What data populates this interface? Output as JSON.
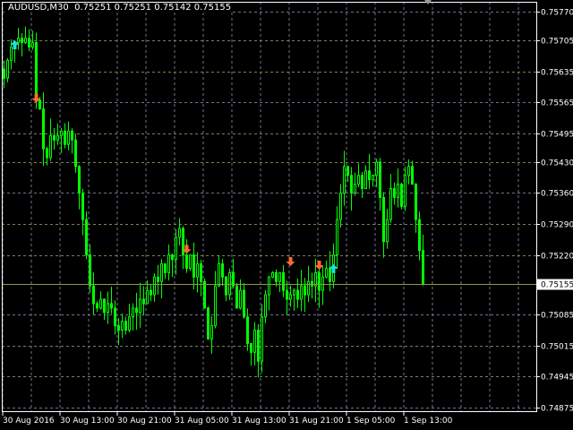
{
  "header": {
    "symbol": "AUDUSD,M30",
    "open": "0.75251",
    "high": "0.75251",
    "low": "0.75142",
    "close": "0.75155"
  },
  "colors": {
    "background": "#000000",
    "candle": "#00ff00",
    "grid": "#6e7390",
    "grid_alt": "#7f8050",
    "frame": "#ffffff",
    "bid_line": "#8f9a3c",
    "arrow_down": "#ff6a32",
    "arrow_up": "#20e0e0"
  },
  "price_axis": {
    "range": [
      0.74875,
      0.7577
    ],
    "ticks": [
      "0.75770",
      "0.75705",
      "0.75635",
      "0.75565",
      "0.75495",
      "0.75430",
      "0.75360",
      "0.75290",
      "0.75220",
      "0.75085",
      "0.75015",
      "0.74945",
      "0.74875"
    ],
    "bid": "0.75155"
  },
  "time_axis": {
    "bars_per_label": 16,
    "labels": [
      "30 Aug 2016",
      "30 Aug 13:00",
      "30 Aug 21:00",
      "31 Aug 05:00",
      "31 Aug 13:00",
      "31 Aug 21:00",
      "1 Sep 05:00",
      "1 Sep 13:00"
    ]
  },
  "chart_data": {
    "type": "candlestick",
    "timeframe": "M30",
    "closes": [
      0.7562,
      0.7566,
      0.7569,
      0.757,
      0.7571,
      0.757,
      0.7571,
      0.7569,
      0.757,
      0.7557,
      0.7555,
      0.7546,
      0.7544,
      0.7549,
      0.7548,
      0.7549,
      0.755,
      0.7547,
      0.755,
      0.7548,
      0.7542,
      0.7536,
      0.753,
      0.7522,
      0.7515,
      0.7511,
      0.751,
      0.7512,
      0.7509,
      0.7511,
      0.751,
      0.7506,
      0.7505,
      0.7507,
      0.7505,
      0.7508,
      0.751,
      0.7509,
      0.7512,
      0.7511,
      0.7514,
      0.7513,
      0.7517,
      0.7516,
      0.752,
      0.7518,
      0.7522,
      0.7521,
      0.7526,
      0.7528,
      0.7522,
      0.7519,
      0.7522,
      0.7517,
      0.752,
      0.7516,
      0.751,
      0.7503,
      0.7506,
      0.7515,
      0.752,
      0.7517,
      0.7513,
      0.7518,
      0.7515,
      0.751,
      0.7514,
      0.7508,
      0.7502,
      0.75,
      0.7505,
      0.7498,
      0.7508,
      0.7513,
      0.7517,
      0.7518,
      0.7516,
      0.7518,
      0.7514,
      0.7512,
      0.7513,
      0.7514,
      0.7512,
      0.7515,
      0.7513,
      0.7516,
      0.7515,
      0.7518,
      0.7514,
      0.7517,
      0.7519,
      0.7516,
      0.7522,
      0.753,
      0.7536,
      0.7542,
      0.754,
      0.7536,
      0.7538,
      0.754,
      0.7537,
      0.7541,
      0.7539,
      0.754,
      0.7543,
      0.7535,
      0.7525,
      0.753,
      0.7537,
      0.7535,
      0.7538,
      0.7533,
      0.754,
      0.7542,
      0.7538,
      0.753,
      0.7523,
      0.75155
    ],
    "signals": [
      {
        "bar": 3,
        "dir": "up",
        "price": 0.75695
      },
      {
        "bar": 9,
        "dir": "down",
        "price": 0.75574
      },
      {
        "bar": 51,
        "dir": "down",
        "price": 0.75233
      },
      {
        "bar": 80,
        "dir": "down",
        "price": 0.75205
      },
      {
        "bar": 88,
        "dir": "down",
        "price": 0.75197
      },
      {
        "bar": 92,
        "dir": "up",
        "price": 0.75189
      }
    ]
  }
}
